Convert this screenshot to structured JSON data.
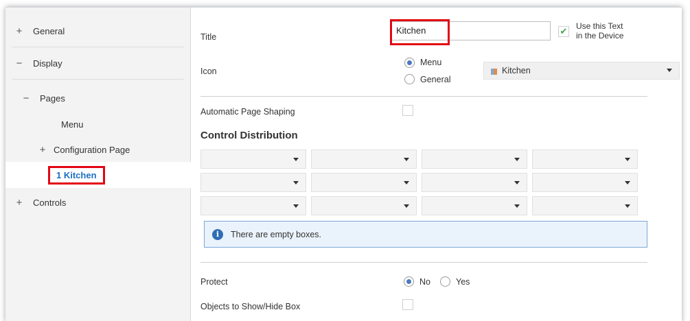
{
  "sidebar": {
    "items": [
      {
        "prefix": "+",
        "label": "General"
      },
      {
        "prefix": "−",
        "label": "Display"
      },
      {
        "prefix": "−",
        "label": "Pages"
      },
      {
        "prefix": "",
        "label": "Menu"
      },
      {
        "prefix": "+",
        "label": "Configuration Page"
      },
      {
        "prefix": "",
        "label": "1  Kitchen"
      },
      {
        "prefix": "+",
        "label": "Controls"
      }
    ]
  },
  "main": {
    "title_label": "Title",
    "title_value": "Kitchen",
    "use_text_label_line1": "Use this Text",
    "use_text_label_line2": "in the Device",
    "icon_label": "Icon",
    "icon_radio_menu": "Menu",
    "icon_radio_general": "General",
    "icon_dropdown_value": "Kitchen",
    "auto_shaping_label": "Automatic Page Shaping",
    "control_distribution_title": "Control Distribution",
    "info_text": "There are empty boxes.",
    "protect_label": "Protect",
    "protect_no": "No",
    "protect_yes": "Yes",
    "objects_label": "Objects to Show/Hide Box"
  },
  "colors": {
    "highlight": "#e30613",
    "selected_text": "#1a6fc4",
    "info_border": "#7aa8d6",
    "radio_fill": "#4a78c2",
    "check_green": "#3fa64a"
  },
  "icons": {
    "expand": "plus-icon",
    "collapse": "minus-icon",
    "info": "info-icon",
    "dropdown": "caret-down-icon",
    "check": "checkmark-icon"
  }
}
